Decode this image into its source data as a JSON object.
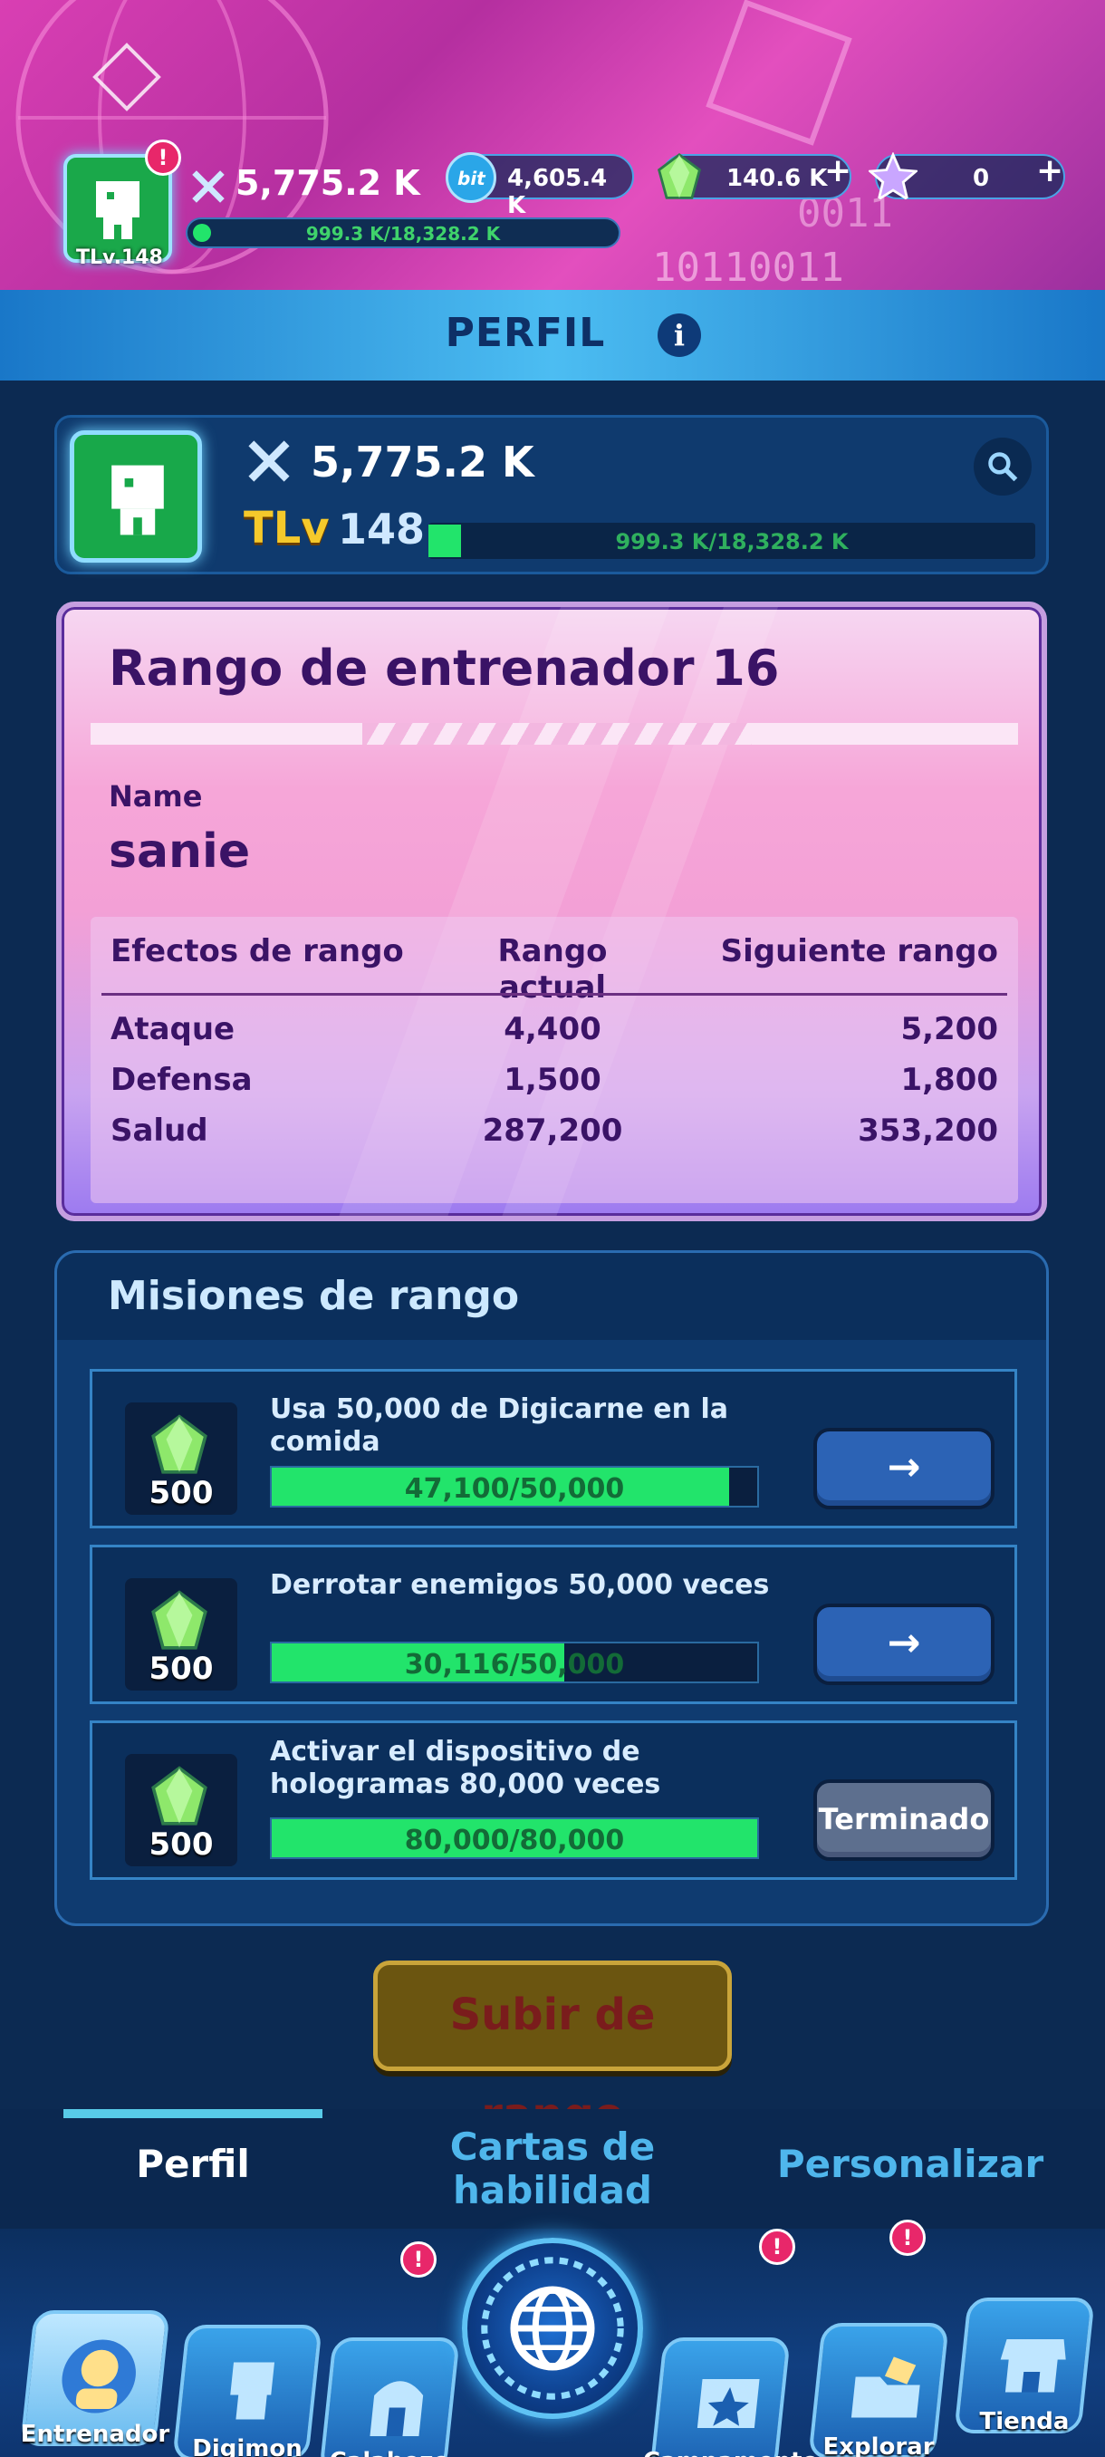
{
  "hud": {
    "avatar_level": "TLv.148",
    "power": "5,775.2 K",
    "xp": "999.3 K/18,328.2 K",
    "bits": "4,605.4 K",
    "crystals": "140.6 K",
    "stars": "0",
    "plus_symbol": "+"
  },
  "title_bar": {
    "title": "PERFIL",
    "info_icon_glyph": "i"
  },
  "profile": {
    "power": "5,775.2 K",
    "tlv_label": "TLv",
    "level": "148",
    "xp": "999.3 K/18,328.2 K",
    "xp_fraction": 0.0545
  },
  "rank": {
    "title": "Rango de entrenador 16",
    "name_label": "Name",
    "name_value": "sanie",
    "headers": [
      "Efectos de rango",
      "Rango actual",
      "Siguiente rango"
    ],
    "rows": [
      {
        "label": "Ataque",
        "current": "4,400",
        "next": "5,200"
      },
      {
        "label": "Defensa",
        "current": "1,500",
        "next": "1,800"
      },
      {
        "label": "Salud",
        "current": "287,200",
        "next": "353,200"
      }
    ]
  },
  "missions": {
    "title": "Misiones de rango",
    "items": [
      {
        "desc": "Usa 50,000 de Digicarne en la comida",
        "reward": "500",
        "progress": "47,100/50,000",
        "fraction": 0.942,
        "action": "→"
      },
      {
        "desc": "Derrotar enemigos 50,000 veces",
        "reward": "500",
        "progress": "30,116/50,000",
        "fraction": 0.602,
        "action": "→"
      },
      {
        "desc": "Activar el dispositivo de hologramas 80,000 veces",
        "reward": "500",
        "progress": "80,000/80,000",
        "fraction": 1.0,
        "action": "Terminado"
      }
    ]
  },
  "rankup_button": "Subir de rango",
  "subnav": {
    "tabs": [
      "Perfil",
      "Cartas de habilidad",
      "Personalizar"
    ]
  },
  "bottom_nav": {
    "items": [
      "Entrenador",
      "Digimon",
      "Calabozo",
      "Campamento",
      "Explorar",
      "Tienda"
    ]
  },
  "colors": {
    "accent_green": "#22e46b",
    "title_blue": "#0e2f66",
    "rank_text": "#3a1366",
    "badge_red": "#e8276a"
  }
}
